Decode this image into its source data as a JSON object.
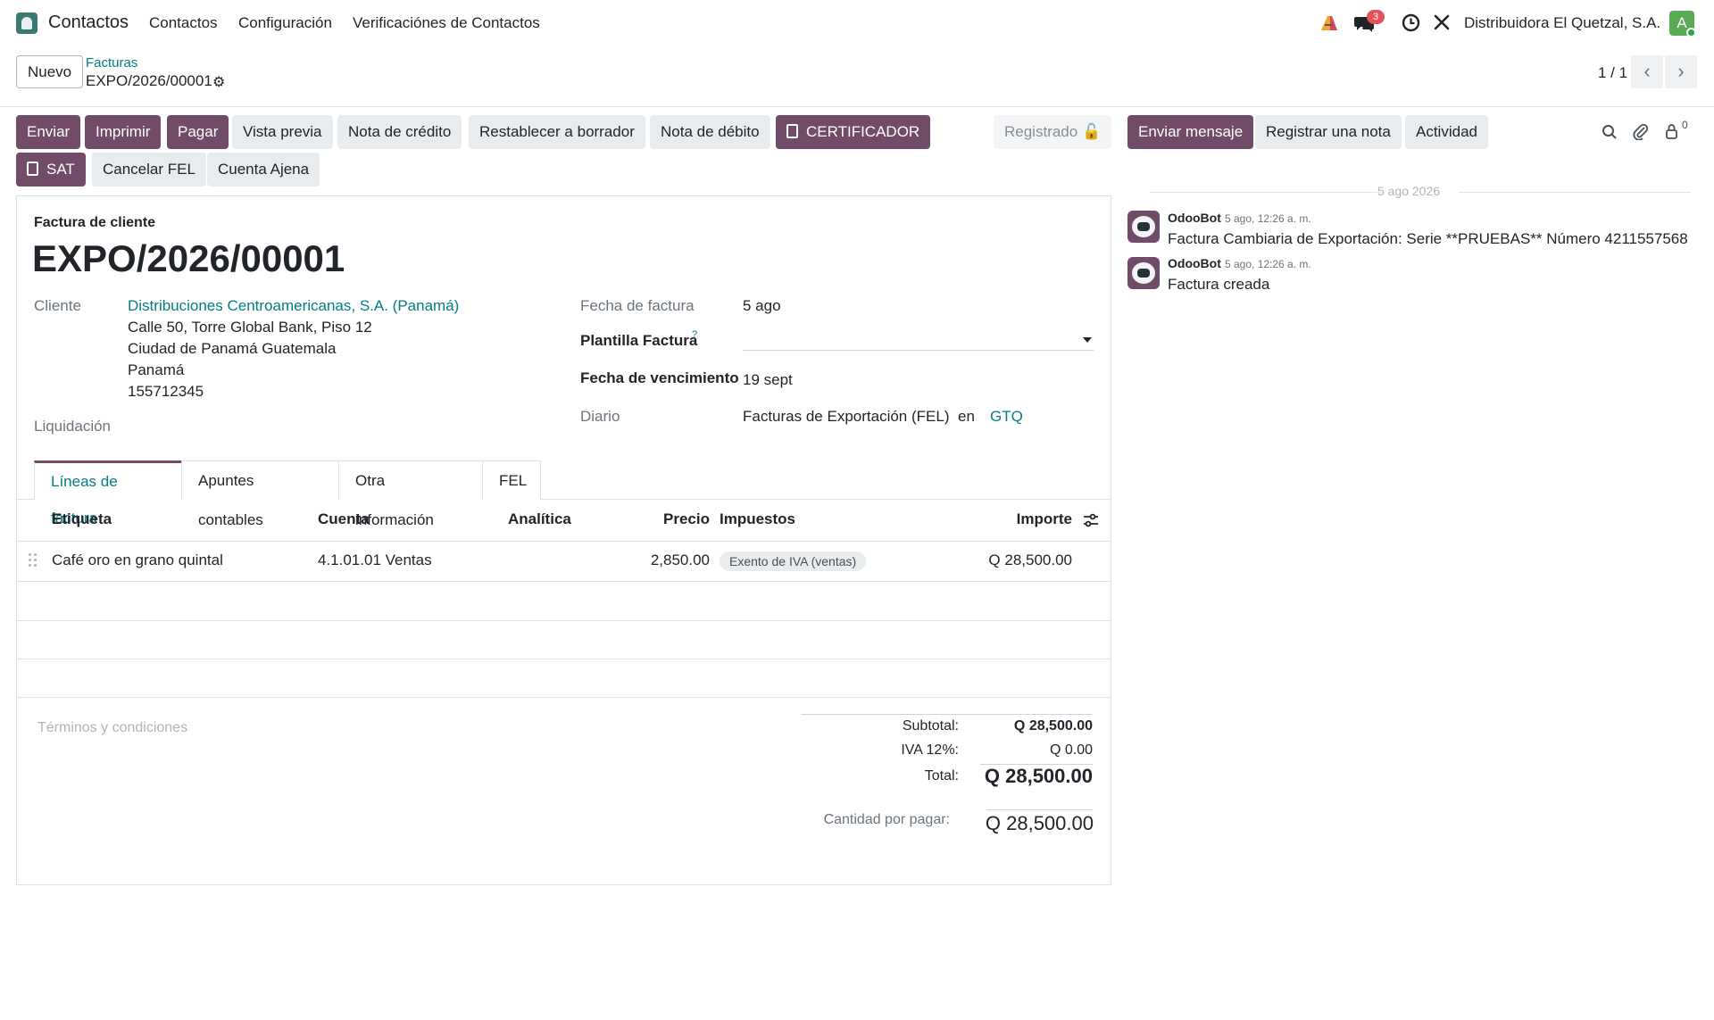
{
  "navbar": {
    "app_name": "Contactos",
    "menu": [
      "Contactos",
      "Configuración",
      "Verificaciónes de Contactos"
    ],
    "messages_count": "3",
    "company": "Distribuidora El Quetzal, S.A.",
    "avatar_letter": "A"
  },
  "control_panel": {
    "new_label": "Nuevo",
    "breadcrumb_parent": "Facturas",
    "breadcrumb_current": "EXPO/2026/00001",
    "pager": "1 / 1"
  },
  "actions": {
    "enviar": "Enviar",
    "imprimir": "Imprimir",
    "pagar": "Pagar",
    "vista_previa": "Vista previa",
    "nota_credito": "Nota de crédito",
    "restablecer": "Restablecer a borrador",
    "nota_debito": "Nota de débito",
    "certificador": "CERTIFICADOR",
    "registrado": "Registrado",
    "sat": "SAT",
    "cancelar_fel": "Cancelar FEL",
    "cuenta_ajena": "Cuenta Ajena"
  },
  "chatter_actions": {
    "enviar_mensaje": "Enviar mensaje",
    "registrar_nota": "Registrar una nota",
    "actividad": "Actividad",
    "followers_count": "0"
  },
  "invoice": {
    "type": "Factura de cliente",
    "number": "EXPO/2026/00001",
    "cliente_label": "Cliente",
    "cliente_name": "Distribuciones Centroamericanas, S.A. (Panamá)",
    "address": [
      "Calle 50, Torre Global Bank, Piso 12",
      "Ciudad de Panamá Guatemala",
      "Panamá",
      "155712345"
    ],
    "liquidacion_label": "Liquidación",
    "fecha_factura_label": "Fecha de factura",
    "fecha_factura": "5 ago",
    "plantilla_label": "Plantilla Factura",
    "plantilla_help": "?",
    "fecha_venc_label": "Fecha de vencimiento",
    "fecha_venc": "19 sept",
    "diario_label": "Diario",
    "diario": "Facturas de Exportación (FEL)",
    "en_label": "en",
    "currency": "GTQ"
  },
  "tabs": [
    "Líneas de factura",
    "Apuntes contables",
    "Otra información",
    "FEL"
  ],
  "lines": {
    "headers": {
      "etiqueta": "Etiqueta",
      "cuenta": "Cuenta",
      "analitica": "Analítica",
      "precio": "Precio",
      "impuestos": "Impuestos",
      "importe": "Importe"
    },
    "rows": [
      {
        "etiqueta": "Café oro en grano quintal",
        "cuenta": "4.1.01.01 Ventas",
        "precio": "2,850.00",
        "impuesto": "Exento de IVA (ventas)",
        "importe": "Q 28,500.00"
      }
    ]
  },
  "totals": {
    "terms_placeholder": "Términos y condiciones",
    "subtotal_label": "Subtotal:",
    "subtotal": "Q 28,500.00",
    "iva_label": "IVA 12%:",
    "iva": "Q 0.00",
    "total_label": "Total:",
    "total": "Q 28,500.00",
    "por_pagar_label": "Cantidad por pagar:",
    "por_pagar": "Q 28,500.00"
  },
  "chatter": {
    "date_separator": "5 ago 2026",
    "messages": [
      {
        "author": "OdooBot",
        "date": "5 ago, 12:26 a. m.",
        "body": "Factura Cambiaria de Exportación: Serie **PRUEBAS** Número 4211557568"
      },
      {
        "author": "OdooBot",
        "date": "5 ago, 12:26 a. m.",
        "body": "Factura creada"
      }
    ]
  },
  "colors": {
    "primary": "#714b67",
    "link": "#017e84",
    "badge": "#e4515a"
  }
}
